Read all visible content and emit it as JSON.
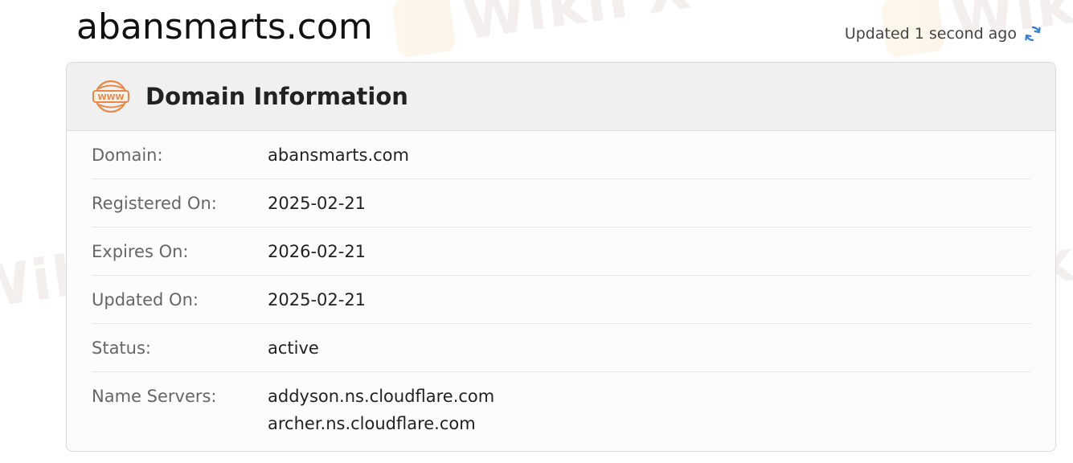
{
  "header": {
    "domain_title": "abansmarts.com",
    "updated_text": "Updated 1 second ago"
  },
  "card": {
    "title": "Domain Information",
    "icon_name": "www-globe-icon",
    "accent_color": "#e8894a"
  },
  "watermark": {
    "text": "WikiFX"
  },
  "rows": [
    {
      "label": "Domain:",
      "value": "abansmarts.com"
    },
    {
      "label": "Registered On:",
      "value": "2025-02-21"
    },
    {
      "label": "Expires On:",
      "value": "2026-02-21"
    },
    {
      "label": "Updated On:",
      "value": "2025-02-21"
    },
    {
      "label": "Status:",
      "value": "active"
    },
    {
      "label": "Name Servers:",
      "values": [
        "addyson.ns.cloudflare.com",
        "archer.ns.cloudflare.com"
      ]
    }
  ]
}
